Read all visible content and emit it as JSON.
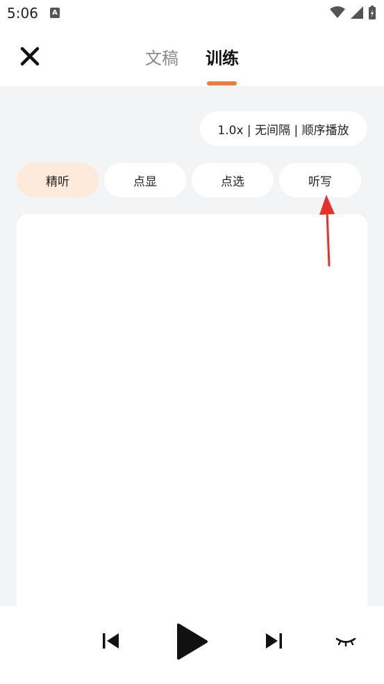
{
  "status_bar": {
    "time": "5:06",
    "app_icon_letter": "A",
    "icons": [
      "wifi-icon",
      "cell-signal-icon",
      "battery-charging-icon"
    ]
  },
  "header": {
    "close_icon": "close-icon",
    "tabs": [
      {
        "label": "文稿",
        "active": false
      },
      {
        "label": "训练",
        "active": true
      }
    ],
    "accent_color": "#f07b3f"
  },
  "playback_settings": {
    "label": "1.0x | 无间隔 | 顺序播放"
  },
  "modes": [
    {
      "label": "精听",
      "active": true
    },
    {
      "label": "点显",
      "active": false
    },
    {
      "label": "点选",
      "active": false
    },
    {
      "label": "听写",
      "active": false
    }
  ],
  "annotation": {
    "arrow_color": "#e8302a",
    "points_to": "听写"
  },
  "player": {
    "controls": [
      "previous-icon",
      "play-icon",
      "next-icon",
      "eye-closed-icon"
    ]
  },
  "colors": {
    "background": "#f3f4f6",
    "active_chip": "#fdeadb"
  }
}
